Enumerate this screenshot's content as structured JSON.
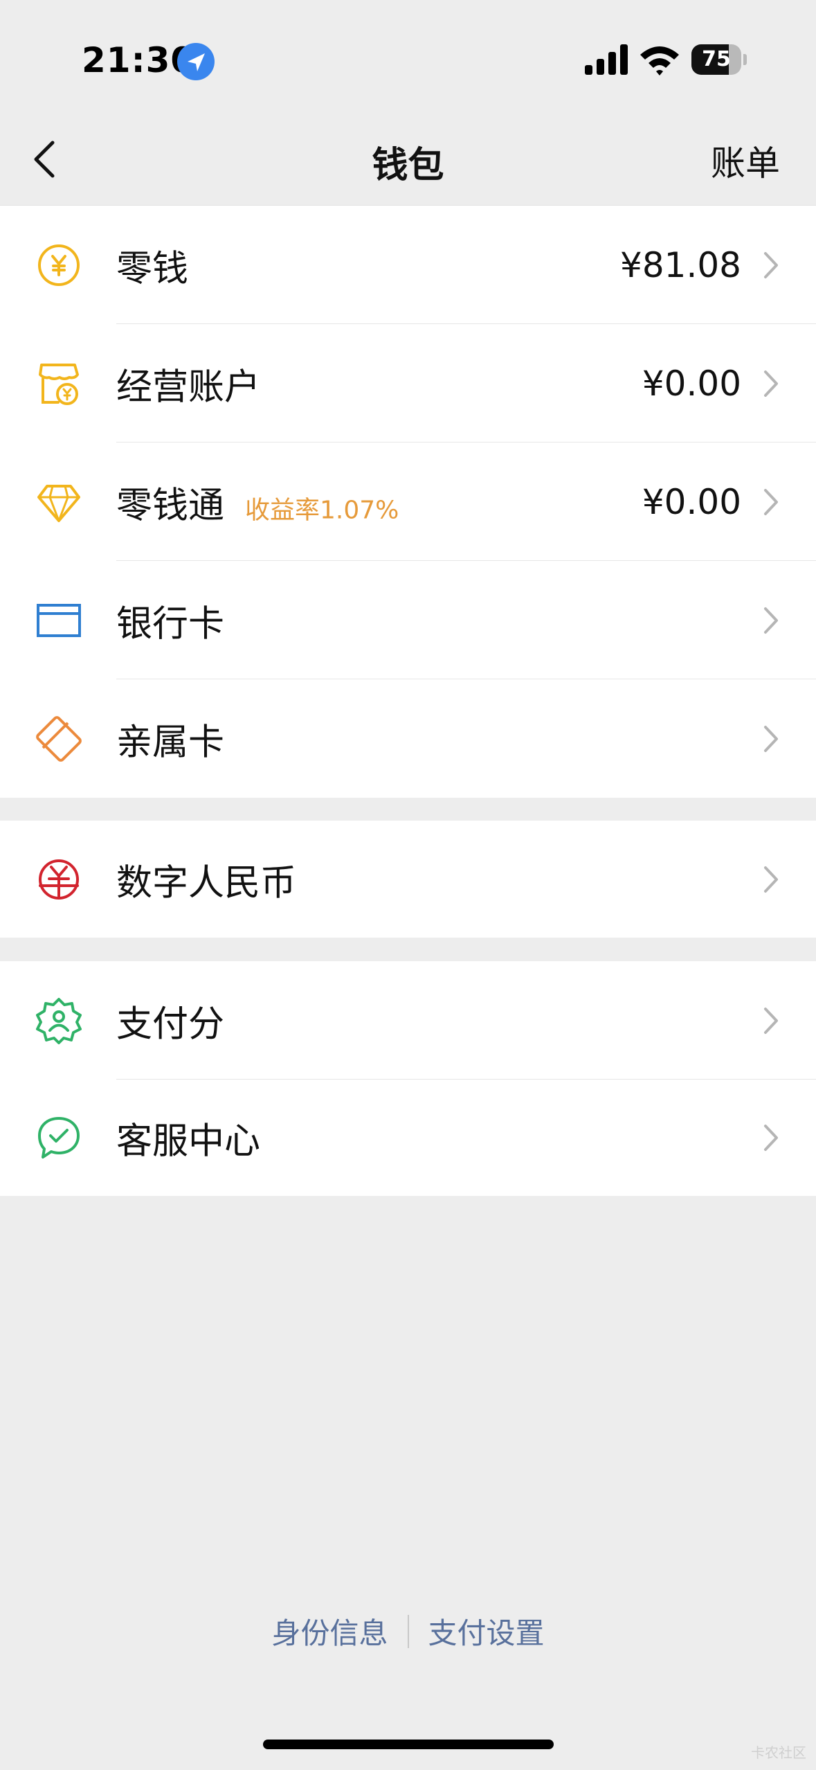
{
  "status_bar": {
    "time": "21:30",
    "battery": "75",
    "battery_level": 0.75
  },
  "nav": {
    "title": "钱包",
    "right": "账单",
    "back_icon": "chevron-left-icon"
  },
  "section1": [
    {
      "label": "零钱",
      "value": "¥81.08",
      "icon": "yuan-coin-icon",
      "color": "#f2b51c"
    },
    {
      "label": "经营账户",
      "value": "¥0.00",
      "icon": "shop-account-icon",
      "color": "#f2b51c"
    },
    {
      "label": "零钱通",
      "badge": "收益率1.07%",
      "value": "¥0.00",
      "icon": "diamond-icon",
      "color": "#f2b51c"
    },
    {
      "label": "银行卡",
      "icon": "bank-card-icon",
      "color": "#2f7fd1"
    },
    {
      "label": "亲属卡",
      "icon": "family-card-icon",
      "color": "#ec8a3c"
    }
  ],
  "section2": [
    {
      "label": "数字人民币",
      "icon": "digital-rmb-icon",
      "color": "#d2242e"
    }
  ],
  "section3": [
    {
      "label": "支付分",
      "icon": "pay-score-icon",
      "color": "#2fb267"
    },
    {
      "label": "客服中心",
      "icon": "customer-service-icon",
      "color": "#2fb267"
    }
  ],
  "footer": {
    "link1": "身份信息",
    "link2": "支付设置"
  },
  "watermark": "卡农社区"
}
